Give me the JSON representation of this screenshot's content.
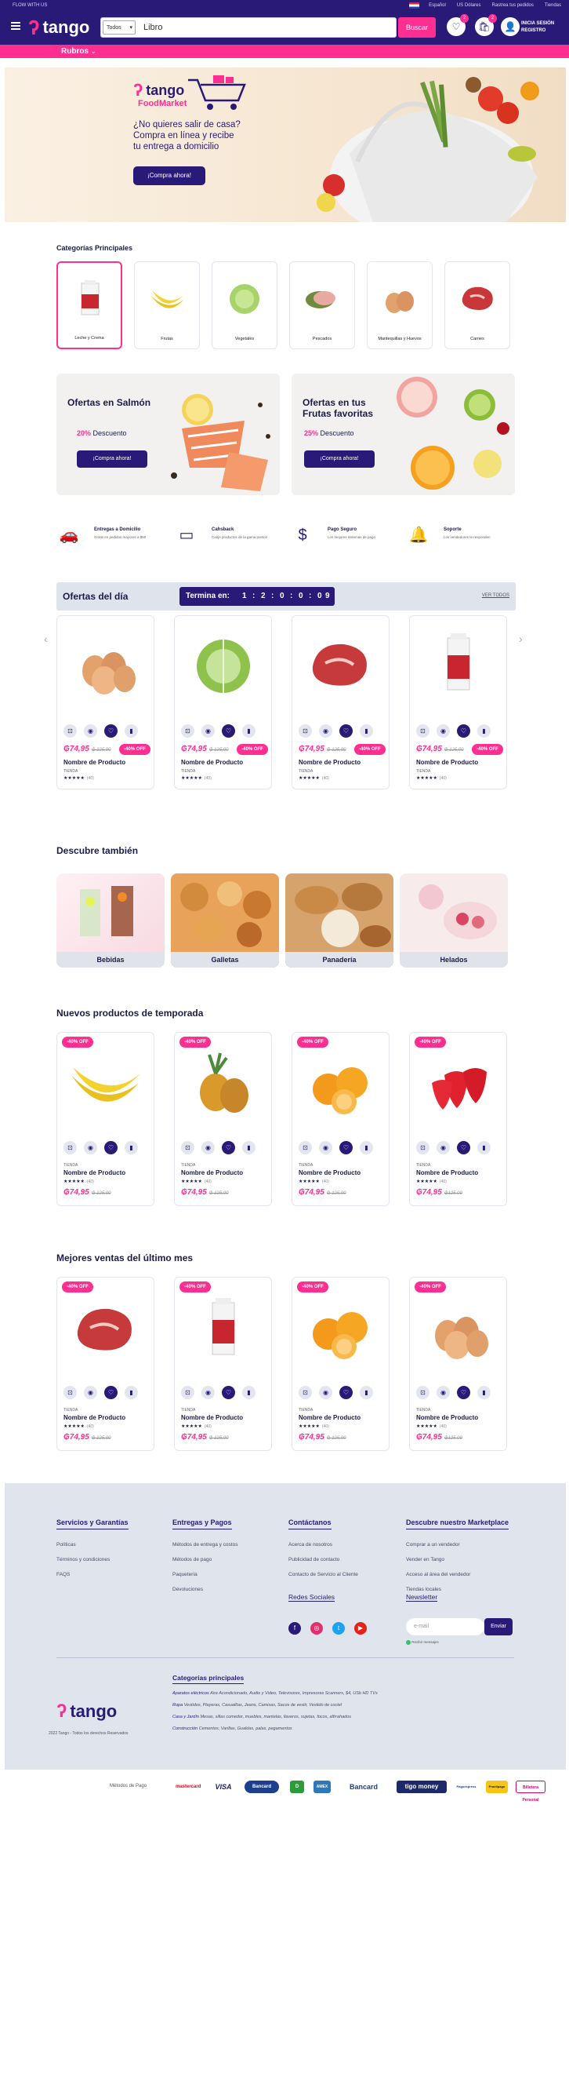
{
  "topbar": {
    "flow": "FLOW WITH US",
    "lang": "Español",
    "currency": "US Dólares",
    "track": "Rastrea tus pedidos",
    "stores": "Tiendas"
  },
  "header": {
    "logo_text": "tango",
    "search_select": "Todos",
    "search_value": "Libro",
    "search_button": "Buscar",
    "wishlist_count": "2",
    "cart_count": "2",
    "login_line1": "INICIA SESIÓN",
    "login_line2": "REGISTRO"
  },
  "nav": {
    "rubros": "Rubros"
  },
  "hero": {
    "brand_small": "tango",
    "brand_sub": "FoodMarket",
    "line1": "¿No quieres salir de casa?",
    "line2": "Compra en línea y recibe",
    "line3": "tu entrega a domicilio",
    "button": "¡Compra ahora!"
  },
  "categories": {
    "title": "Categorías Principales",
    "items": [
      "Leche y Crema",
      "Frutas",
      "Vegetales",
      "Pescados",
      "Mantequillas y Huevos",
      "Carnes"
    ]
  },
  "promos": [
    {
      "title1": "Ofertas en",
      "title2": "Salmón",
      "percent": "20%",
      "desc": "Descuento",
      "button": "¡Compra ahora!"
    },
    {
      "title1": "Ofertas en tus",
      "title2": "Frutas favoritas",
      "percent": "25%",
      "desc": "Descuento",
      "button": "¡Compra ahora!"
    }
  ],
  "features": [
    {
      "title": "Entregas a Domicilio",
      "sub": "Gratis en pedidos mayores a $50"
    },
    {
      "title": "Cahsback",
      "sub": "Canje productos de la gama puntos"
    },
    {
      "title": "Pago Seguro",
      "sub": "Los mejores sistemas de pago"
    },
    {
      "title": "Soporte",
      "sub": "Los vendedores te responden"
    }
  ],
  "deals": {
    "title": "Ofertas del día",
    "timer_label": "Termina en:",
    "timer": [
      "1",
      "2",
      "0",
      "0",
      "0",
      "9"
    ],
    "view_all": "VER TODOS",
    "products": [
      {
        "name": "Nombre de Producto",
        "price": "₲74,95",
        "old": "₲ 125,00",
        "off": "-40% OFF",
        "store": "TIENDA",
        "rating": "★★★★★",
        "reviews": "(40)",
        "img": "eggs"
      },
      {
        "name": "Nombre de Producto",
        "price": "₲74,95",
        "old": "₲ 125,00",
        "off": "-40% OFF",
        "store": "TIENDA",
        "rating": "★★★★★",
        "reviews": "(40)",
        "img": "cabbage"
      },
      {
        "name": "Nombre de Producto",
        "price": "₲74,95",
        "old": "₲ 125,00",
        "off": "-40% OFF",
        "store": "TIENDA",
        "rating": "★★★★★",
        "reviews": "(40)",
        "img": "meat"
      },
      {
        "name": "Nombre de Producto",
        "price": "₲74,95",
        "old": "₲ 125,00",
        "off": "-40% OFF",
        "store": "TIENDA",
        "rating": "★★★★★",
        "reviews": "(40)",
        "img": "milk"
      }
    ]
  },
  "discover": {
    "title": "Descubre también",
    "items": [
      "Bebidas",
      "Galletas",
      "Panadería",
      "Helados"
    ]
  },
  "season": {
    "title": "Nuevos productos de temporada",
    "products": [
      {
        "name": "Nombre de Producto",
        "price": "₲74,95",
        "old": "₲ 125,00",
        "off": "-40% OFF",
        "store": "TIENDA",
        "rating": "★★★★★",
        "reviews": "(40)",
        "img": "banana"
      },
      {
        "name": "Nombre de Producto",
        "price": "₲74,95",
        "old": "₲ 125,00",
        "off": "-40% OFF",
        "store": "TIENDA",
        "rating": "★★★★★",
        "reviews": "(40)",
        "img": "pineapple"
      },
      {
        "name": "Nombre de Producto",
        "price": "₲74,95",
        "old": "₲ 125,00",
        "off": "-40% OFF",
        "store": "TIENDA",
        "rating": "★★★★★",
        "reviews": "(40)",
        "img": "orange"
      },
      {
        "name": "Nombre de Producto",
        "price": "₲74,95",
        "old": "₲125,00",
        "off": "-40% OFF",
        "store": "TIENDA",
        "rating": "★★★★★",
        "reviews": "(40)",
        "img": "strawberry"
      }
    ]
  },
  "best": {
    "title": "Mejores ventas del último mes",
    "products": [
      {
        "name": "Nombre de Producto",
        "price": "₲74,95",
        "old": "₲ 125,00",
        "off": "-40% OFF",
        "store": "TIENDA",
        "rating": "★★★★★",
        "reviews": "(40)",
        "img": "meat"
      },
      {
        "name": "Nombre de Producto",
        "price": "₲74,95",
        "old": "₲ 125,00",
        "off": "-40% OFF",
        "store": "TIENDA",
        "rating": "★★★★★",
        "reviews": "(40)",
        "img": "milk"
      },
      {
        "name": "Nombre de Producto",
        "price": "₲74,95",
        "old": "₲ 125,00",
        "off": "-40% OFF",
        "store": "TIENDA",
        "rating": "★★★★★",
        "reviews": "(40)",
        "img": "orange"
      },
      {
        "name": "Nombre de Producto",
        "price": "₲74,95",
        "old": "₲125,00",
        "off": "-40% OFF",
        "store": "TIENDA",
        "rating": "★★★★★",
        "reviews": "(40)",
        "img": "eggs"
      }
    ]
  },
  "footer": {
    "cols": [
      {
        "title": "Servicios y Garantías",
        "links": [
          "Políticas",
          "Términos y condiciones",
          "FAQS"
        ]
      },
      {
        "title": "Entregas y Pagos",
        "links": [
          "Métodos de entrega y costos",
          "Métodos de pago",
          "Paquetería",
          "Devoluciones"
        ]
      },
      {
        "title": "Contáctanos",
        "links": [
          "Acerca de nosotros",
          "Publicidad de contacto",
          "Contacto de Servicio al Cliente"
        ]
      },
      {
        "title": "Descubre nuestro Marketplace",
        "links": [
          "Comprar a un vendedor",
          "Vender en Tango",
          "Acceso al área del vendedor",
          "Tiendas locales"
        ]
      }
    ],
    "social_title": "Redes Sociales",
    "newsletter_title": "Newsletter",
    "newsletter_placeholder": "e-mail",
    "newsletter_button": "Enviar",
    "newsletter_note": "Recibir mensajes",
    "copyright": "2022 Tango - Todos los derechos Reservados",
    "cat_title": "Categorías principales",
    "cat_lines": [
      {
        "head": "Aparatos eléctricos",
        "rest": "Aire Acondicionado, Audio y Video, Televisores, Impresoras Scanners, $4, USb HD TVs"
      },
      {
        "head": "Ropa",
        "rest": "Vestidos, Playeras, Casuallías, Jeans, Camisas, Sacos de vestir, Vestido de coctel"
      },
      {
        "head": "Casa y Jardín",
        "rest": "Mesas, sillas comedor, muebles, mantelas, llaveros, sujetas, focos, alfrrahados"
      },
      {
        "head": "Construcción",
        "rest": "Cementos, Varillas, Gualdas, palas, pegamentos"
      }
    ],
    "payments_label": "Métodos de Pago",
    "payments": [
      "mastercard",
      "VISA",
      "Bancard",
      "D",
      "AMEX",
      "Bancard",
      "tigo money",
      "Pagoexpress",
      "Practipago",
      "Billetera Personal"
    ]
  }
}
